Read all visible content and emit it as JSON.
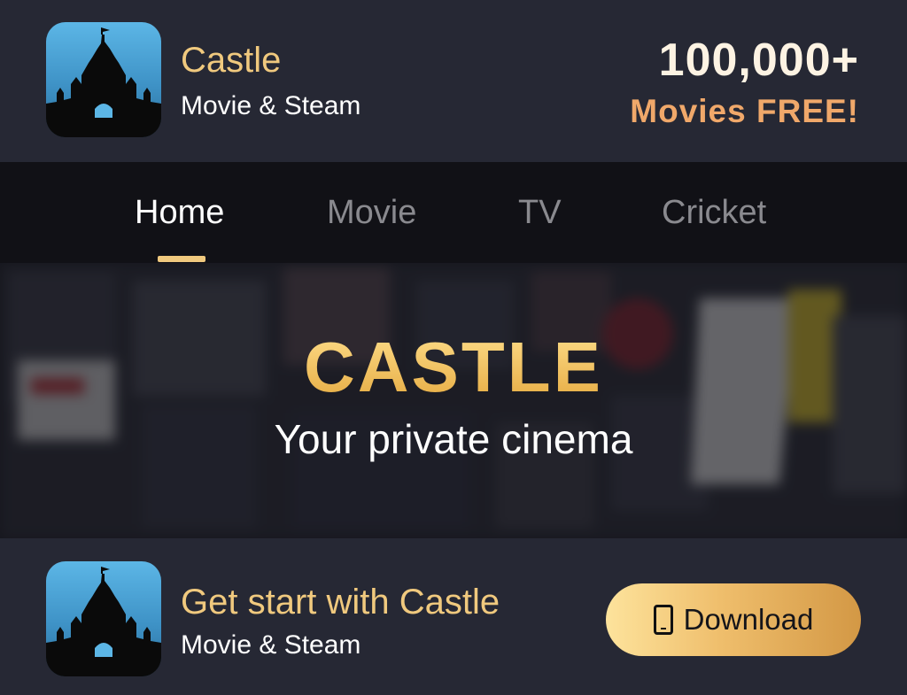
{
  "header": {
    "brand_title": "Castle",
    "brand_subtitle": "Movie & Steam",
    "promo_count": "100,000+",
    "promo_text": "Movies FREE!"
  },
  "nav": {
    "tabs": [
      {
        "label": "Home",
        "active": true
      },
      {
        "label": "Movie",
        "active": false
      },
      {
        "label": "TV",
        "active": false
      },
      {
        "label": "Cricket",
        "active": false
      }
    ]
  },
  "hero": {
    "title": "CASTLE",
    "tagline": "Your private cinema"
  },
  "footer": {
    "title": "Get start with Castle",
    "subtitle": "Movie & Steam",
    "download_label": "Download"
  },
  "icons": {
    "app": "castle-icon",
    "download": "phone-icon"
  },
  "colors": {
    "accent_gold": "#f0c97e",
    "promo_orange": "#f0a86a",
    "background": "#262834",
    "nav_background": "#111116"
  }
}
